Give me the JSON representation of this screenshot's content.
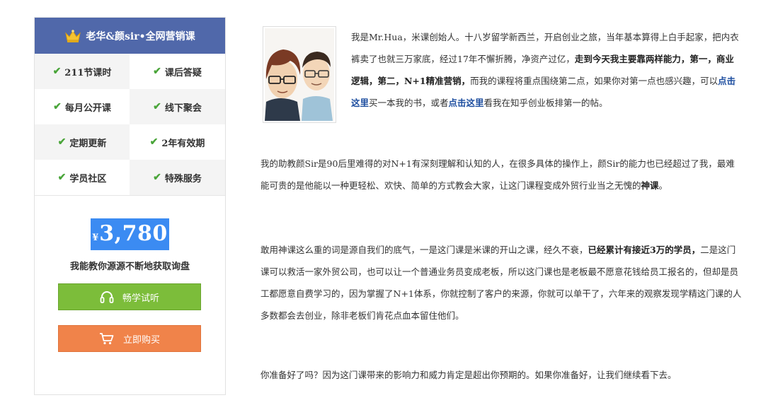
{
  "card": {
    "title": "老华&颜sir•全网营销课",
    "features": [
      {
        "label": "211节课时"
      },
      {
        "label": "课后答疑"
      },
      {
        "label": "每月公开课"
      },
      {
        "label": "线下聚会"
      },
      {
        "label": "定期更新"
      },
      {
        "label": "2年有效期"
      },
      {
        "label": "学员社区"
      },
      {
        "label": "特殊服务"
      }
    ],
    "currency": "¥",
    "price": "3,780",
    "slogan": "我能教你源源不断地获取询盘",
    "listen_label": "畅学试听",
    "buy_label": "立即购买"
  },
  "colors": {
    "header_bg": "#5068aa",
    "price_bg": "#3b8bf2",
    "listen_btn": "#7cbd3a",
    "buy_btn": "#f0834a",
    "link": "#1f4fa0",
    "check": "#4aa53a"
  },
  "icons": {
    "header": "crown-icon",
    "feature": "check-icon",
    "listen": "headphones-icon",
    "buy": "shopping-cart-icon"
  },
  "article": {
    "p1_a": "我是Mr.Hua，米课创始人。十八岁留学新西兰，开启创业之旅，当年基本算得上白手起家，把内衣裤卖了也就三万家底，经过17年不懈折腾，净资产过亿，",
    "p1_bold": "走到今天我主要靠两样能力，第一，商业逻辑，第二，N+1精准营销，",
    "p1_b": "而我的课程将重点围绕第二点，如果你对第一点也感兴趣，可以",
    "p1_link1": "点击这里",
    "p1_c": "买一本我的书，或者",
    "p1_link2": "点击这里",
    "p1_d": "看我在知乎创业板排第一的帖。",
    "p2_a": "我的助教颜Sir是90后里难得的对N+1有深刻理解和认知的人，在很多具体的操作上，颜Sir的能力也已经超过了我，最难能可贵的是他能以一种更轻松、欢快、简单的方式教会大家，让这门课程变成外贸行业当之无愧的",
    "p2_bold": "神课",
    "p2_b": "。",
    "p3_a": "敢用神课这么重的词是源自我们的底气，一是这门课是米课的开山之课，经久不衰，",
    "p3_bold": "已经累计有接近3万的学员，",
    "p3_b": "二是这门课可以救活一家外贸公司，也可以让一个普通业务员变成老板，所以这门课也是老板最不愿意花钱给员工报名的，但却是员工都愿意自费学习的，因为掌握了N+1体系，你就控制了客户的来源，你就可以单干了，六年来的观察发现学精这门课的人多数都会去创业，除非老板们肯花点血本留住他们。",
    "p4": "你准备好了吗？因为这门课带来的影响力和威力肯定是超出你预期的。如果你准备好，让我们继续看下去。"
  }
}
